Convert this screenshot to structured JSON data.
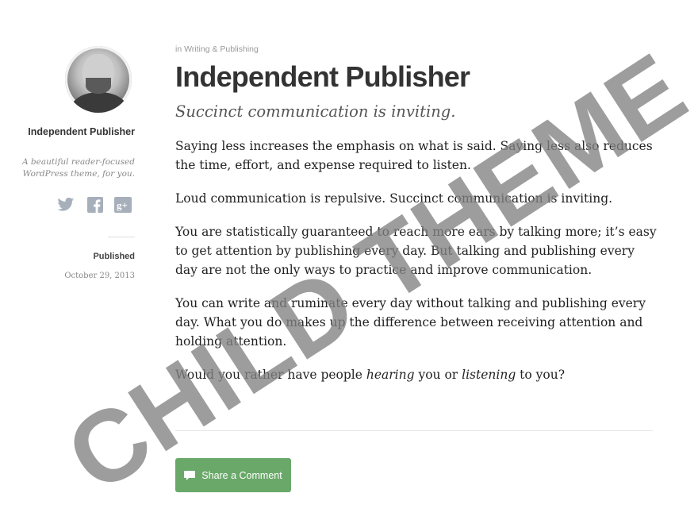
{
  "sidebar": {
    "site_title": "Independent Publisher",
    "site_description": "A beautiful reader-focused WordPress theme, for you.",
    "social_icons": [
      "twitter-icon",
      "facebook-icon",
      "google-plus-icon"
    ],
    "published_label": "Published",
    "published_date": "October 29, 2013"
  },
  "post": {
    "category": "in Writing & Publishing",
    "title": "Independent Publisher",
    "subtitle": "Succinct communication is inviting.",
    "p1": "Saying less increases the emphasis on what is said. Saying less also reduces the time, effort, and expense required to listen.",
    "p2": "Loud communication is repulsive. Succinct communication is inviting.",
    "p3": "You are statistically guaranteed to reach more ears by talking more; it’s easy to get attention by publishing every day. But talking and publishing every day are not the only ways to practice and improve communication.",
    "p4": "You can write and ruminate every day without talking and publishing every day. What you do makes up the difference between receiving attention and holding attention.",
    "p5_pre": "Would you rather have people ",
    "p5_em1": "hearing",
    "p5_mid": " you or ",
    "p5_em2": "listening",
    "p5_post": " to you?"
  },
  "share_button": {
    "label": "Share a Comment",
    "icon": "comment-icon",
    "color": "#6aa86a"
  },
  "watermark": {
    "text": "CHILD THEME"
  }
}
